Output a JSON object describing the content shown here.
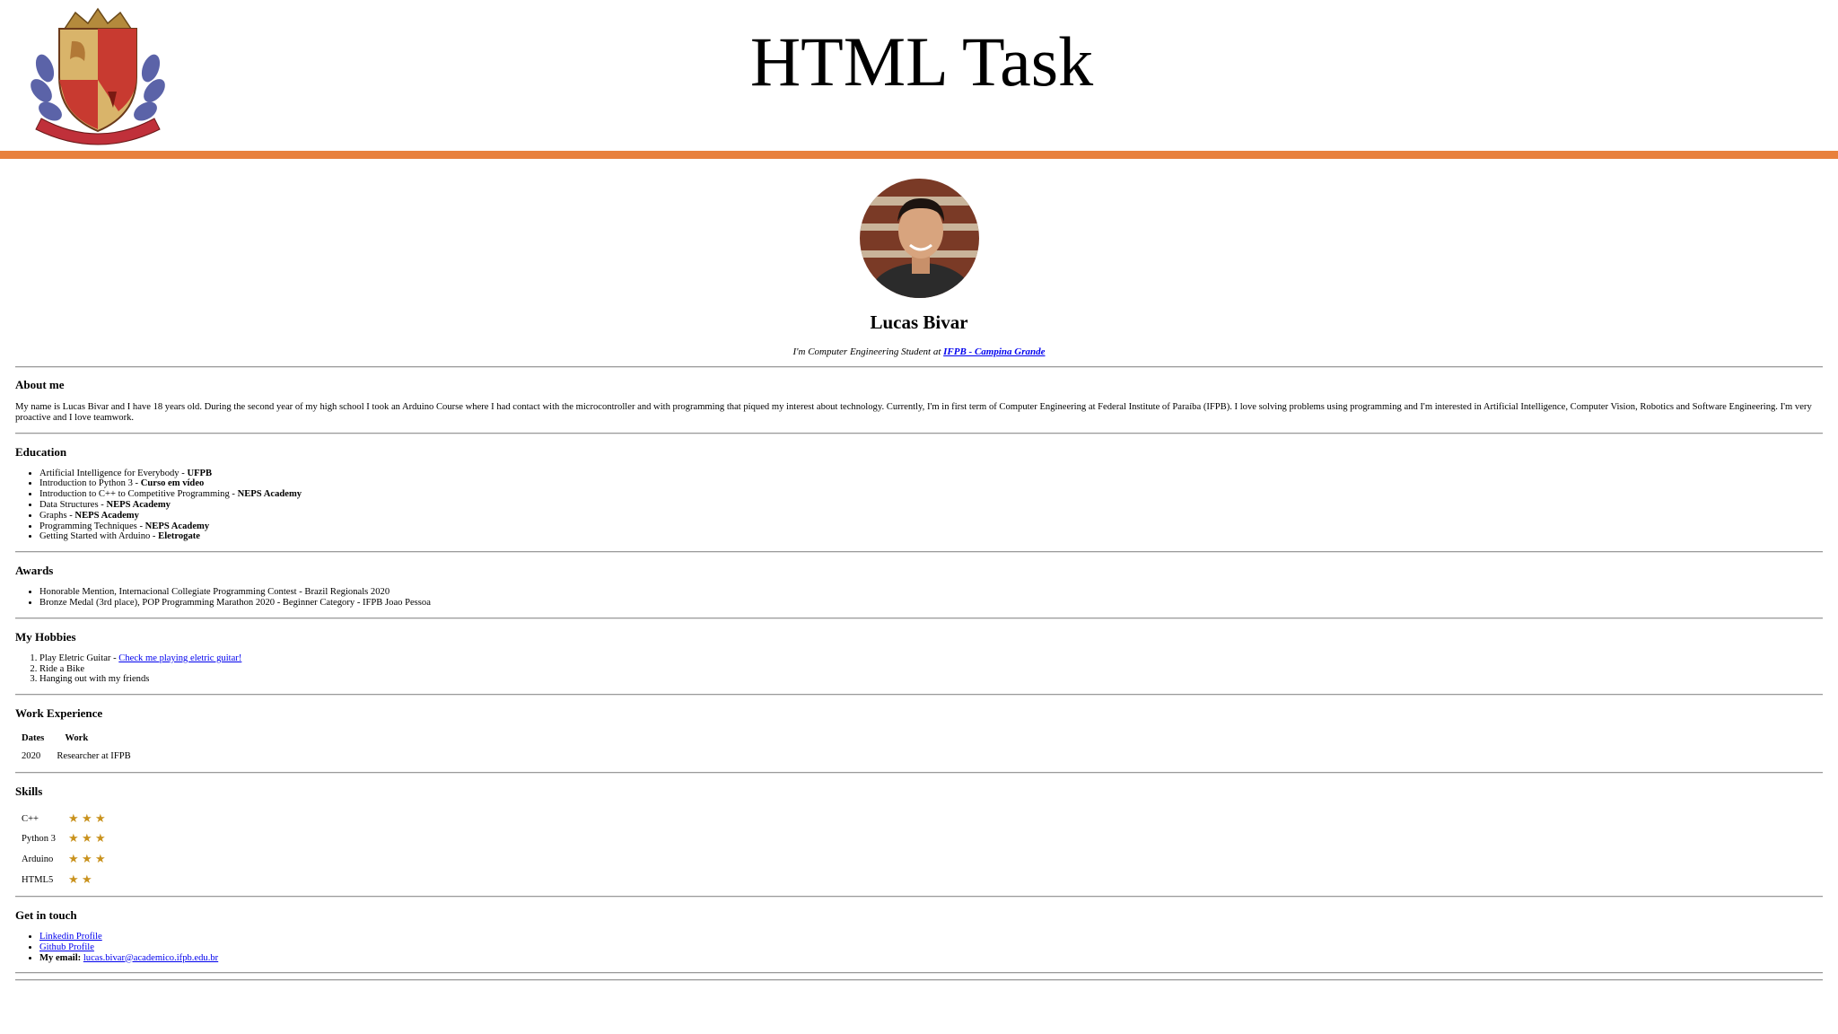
{
  "header": {
    "title": "HTML Task",
    "logo_icon": "university-crest-icon",
    "bar_color": "#e8803c"
  },
  "profile": {
    "avatar_icon": "profile-photo-avatar",
    "name": "Lucas Bivar",
    "subtitle_prefix": "I'm Computer Engineering Student at ",
    "subtitle_link": "IFPB - Campina Grande"
  },
  "about": {
    "heading": "About me",
    "text": "My name is Lucas Bivar and I have 18 years old. During the second year of my high school I took an Arduino Course where I had contact with the microcontroller and with programming that piqued my interest about technology. Currently, I'm in first term of Computer Engineering at Federal Institute of Paraíba (IFPB). I love solving problems using programming and I'm interested in Artificial Intelligence, Computer Vision, Robotics and Software Engineering. I'm very proactive and I love teamwork."
  },
  "education": {
    "heading": "Education",
    "items": [
      {
        "course": "Artificial Intelligence for Everybody - ",
        "institution": "UFPB"
      },
      {
        "course": "Introduction to Python 3 - ",
        "institution": "Curso em vídeo"
      },
      {
        "course": "Introduction to C++ to Competitive Programming - ",
        "institution": "NEPS Academy"
      },
      {
        "course": "Data Structures - ",
        "institution": "NEPS Academy"
      },
      {
        "course": "Graphs - ",
        "institution": "NEPS Academy"
      },
      {
        "course": "Programming Techniques - ",
        "institution": "NEPS Academy"
      },
      {
        "course": "Getting Started with Arduino - ",
        "institution": "Eletrogate"
      }
    ]
  },
  "awards": {
    "heading": "Awards",
    "items": [
      "Honorable Mention, Internacional Collegiate Programming Contest - Brazil Regionals 2020",
      "Bronze Medal (3rd place), POP Programming Marathon 2020 - Beginner Category - IFPB Joao Pessoa"
    ]
  },
  "hobbies": {
    "heading": "My Hobbies",
    "items": [
      {
        "text": "Play Eletric Guitar - ",
        "link": "Check me playing eletric guitar!"
      },
      {
        "text": "Ride a Bike",
        "link": ""
      },
      {
        "text": "Hanging out with my friends",
        "link": ""
      }
    ]
  },
  "work": {
    "heading": "Work Experience",
    "columns": [
      "Dates",
      "Work"
    ],
    "rows": [
      [
        "2020",
        "Researcher at IFPB"
      ]
    ]
  },
  "skills": {
    "heading": "Skills",
    "star_color": "#c9921d",
    "items": [
      {
        "name": "C++",
        "rating": 3
      },
      {
        "name": "Python 3",
        "rating": 3
      },
      {
        "name": "Arduino",
        "rating": 3
      },
      {
        "name": "HTML5",
        "rating": 2
      }
    ]
  },
  "contact": {
    "heading": "Get in touch",
    "linkedin": "Linkedin Profile",
    "github": "Github Profile",
    "email_label": "My email:",
    "email": "lucas.bivar@academico.ifpb.edu.br"
  }
}
